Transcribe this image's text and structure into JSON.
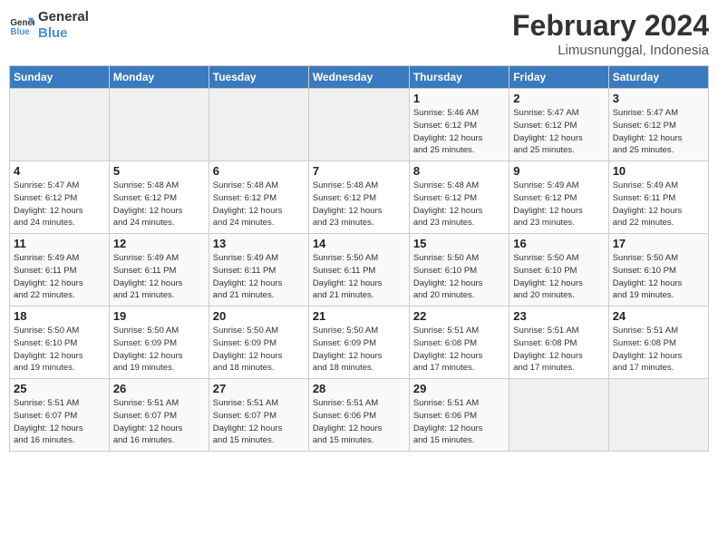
{
  "logo": {
    "line1": "General",
    "line2": "Blue"
  },
  "title": "February 2024",
  "subtitle": "Limusnunggal, Indonesia",
  "days_of_week": [
    "Sunday",
    "Monday",
    "Tuesday",
    "Wednesday",
    "Thursday",
    "Friday",
    "Saturday"
  ],
  "weeks": [
    [
      {
        "day": "",
        "info": ""
      },
      {
        "day": "",
        "info": ""
      },
      {
        "day": "",
        "info": ""
      },
      {
        "day": "",
        "info": ""
      },
      {
        "day": "1",
        "info": "Sunrise: 5:46 AM\nSunset: 6:12 PM\nDaylight: 12 hours\nand 25 minutes."
      },
      {
        "day": "2",
        "info": "Sunrise: 5:47 AM\nSunset: 6:12 PM\nDaylight: 12 hours\nand 25 minutes."
      },
      {
        "day": "3",
        "info": "Sunrise: 5:47 AM\nSunset: 6:12 PM\nDaylight: 12 hours\nand 25 minutes."
      }
    ],
    [
      {
        "day": "4",
        "info": "Sunrise: 5:47 AM\nSunset: 6:12 PM\nDaylight: 12 hours\nand 24 minutes."
      },
      {
        "day": "5",
        "info": "Sunrise: 5:48 AM\nSunset: 6:12 PM\nDaylight: 12 hours\nand 24 minutes."
      },
      {
        "day": "6",
        "info": "Sunrise: 5:48 AM\nSunset: 6:12 PM\nDaylight: 12 hours\nand 24 minutes."
      },
      {
        "day": "7",
        "info": "Sunrise: 5:48 AM\nSunset: 6:12 PM\nDaylight: 12 hours\nand 23 minutes."
      },
      {
        "day": "8",
        "info": "Sunrise: 5:48 AM\nSunset: 6:12 PM\nDaylight: 12 hours\nand 23 minutes."
      },
      {
        "day": "9",
        "info": "Sunrise: 5:49 AM\nSunset: 6:12 PM\nDaylight: 12 hours\nand 23 minutes."
      },
      {
        "day": "10",
        "info": "Sunrise: 5:49 AM\nSunset: 6:11 PM\nDaylight: 12 hours\nand 22 minutes."
      }
    ],
    [
      {
        "day": "11",
        "info": "Sunrise: 5:49 AM\nSunset: 6:11 PM\nDaylight: 12 hours\nand 22 minutes."
      },
      {
        "day": "12",
        "info": "Sunrise: 5:49 AM\nSunset: 6:11 PM\nDaylight: 12 hours\nand 21 minutes."
      },
      {
        "day": "13",
        "info": "Sunrise: 5:49 AM\nSunset: 6:11 PM\nDaylight: 12 hours\nand 21 minutes."
      },
      {
        "day": "14",
        "info": "Sunrise: 5:50 AM\nSunset: 6:11 PM\nDaylight: 12 hours\nand 21 minutes."
      },
      {
        "day": "15",
        "info": "Sunrise: 5:50 AM\nSunset: 6:10 PM\nDaylight: 12 hours\nand 20 minutes."
      },
      {
        "day": "16",
        "info": "Sunrise: 5:50 AM\nSunset: 6:10 PM\nDaylight: 12 hours\nand 20 minutes."
      },
      {
        "day": "17",
        "info": "Sunrise: 5:50 AM\nSunset: 6:10 PM\nDaylight: 12 hours\nand 19 minutes."
      }
    ],
    [
      {
        "day": "18",
        "info": "Sunrise: 5:50 AM\nSunset: 6:10 PM\nDaylight: 12 hours\nand 19 minutes."
      },
      {
        "day": "19",
        "info": "Sunrise: 5:50 AM\nSunset: 6:09 PM\nDaylight: 12 hours\nand 19 minutes."
      },
      {
        "day": "20",
        "info": "Sunrise: 5:50 AM\nSunset: 6:09 PM\nDaylight: 12 hours\nand 18 minutes."
      },
      {
        "day": "21",
        "info": "Sunrise: 5:50 AM\nSunset: 6:09 PM\nDaylight: 12 hours\nand 18 minutes."
      },
      {
        "day": "22",
        "info": "Sunrise: 5:51 AM\nSunset: 6:08 PM\nDaylight: 12 hours\nand 17 minutes."
      },
      {
        "day": "23",
        "info": "Sunrise: 5:51 AM\nSunset: 6:08 PM\nDaylight: 12 hours\nand 17 minutes."
      },
      {
        "day": "24",
        "info": "Sunrise: 5:51 AM\nSunset: 6:08 PM\nDaylight: 12 hours\nand 17 minutes."
      }
    ],
    [
      {
        "day": "25",
        "info": "Sunrise: 5:51 AM\nSunset: 6:07 PM\nDaylight: 12 hours\nand 16 minutes."
      },
      {
        "day": "26",
        "info": "Sunrise: 5:51 AM\nSunset: 6:07 PM\nDaylight: 12 hours\nand 16 minutes."
      },
      {
        "day": "27",
        "info": "Sunrise: 5:51 AM\nSunset: 6:07 PM\nDaylight: 12 hours\nand 15 minutes."
      },
      {
        "day": "28",
        "info": "Sunrise: 5:51 AM\nSunset: 6:06 PM\nDaylight: 12 hours\nand 15 minutes."
      },
      {
        "day": "29",
        "info": "Sunrise: 5:51 AM\nSunset: 6:06 PM\nDaylight: 12 hours\nand 15 minutes."
      },
      {
        "day": "",
        "info": ""
      },
      {
        "day": "",
        "info": ""
      }
    ]
  ]
}
